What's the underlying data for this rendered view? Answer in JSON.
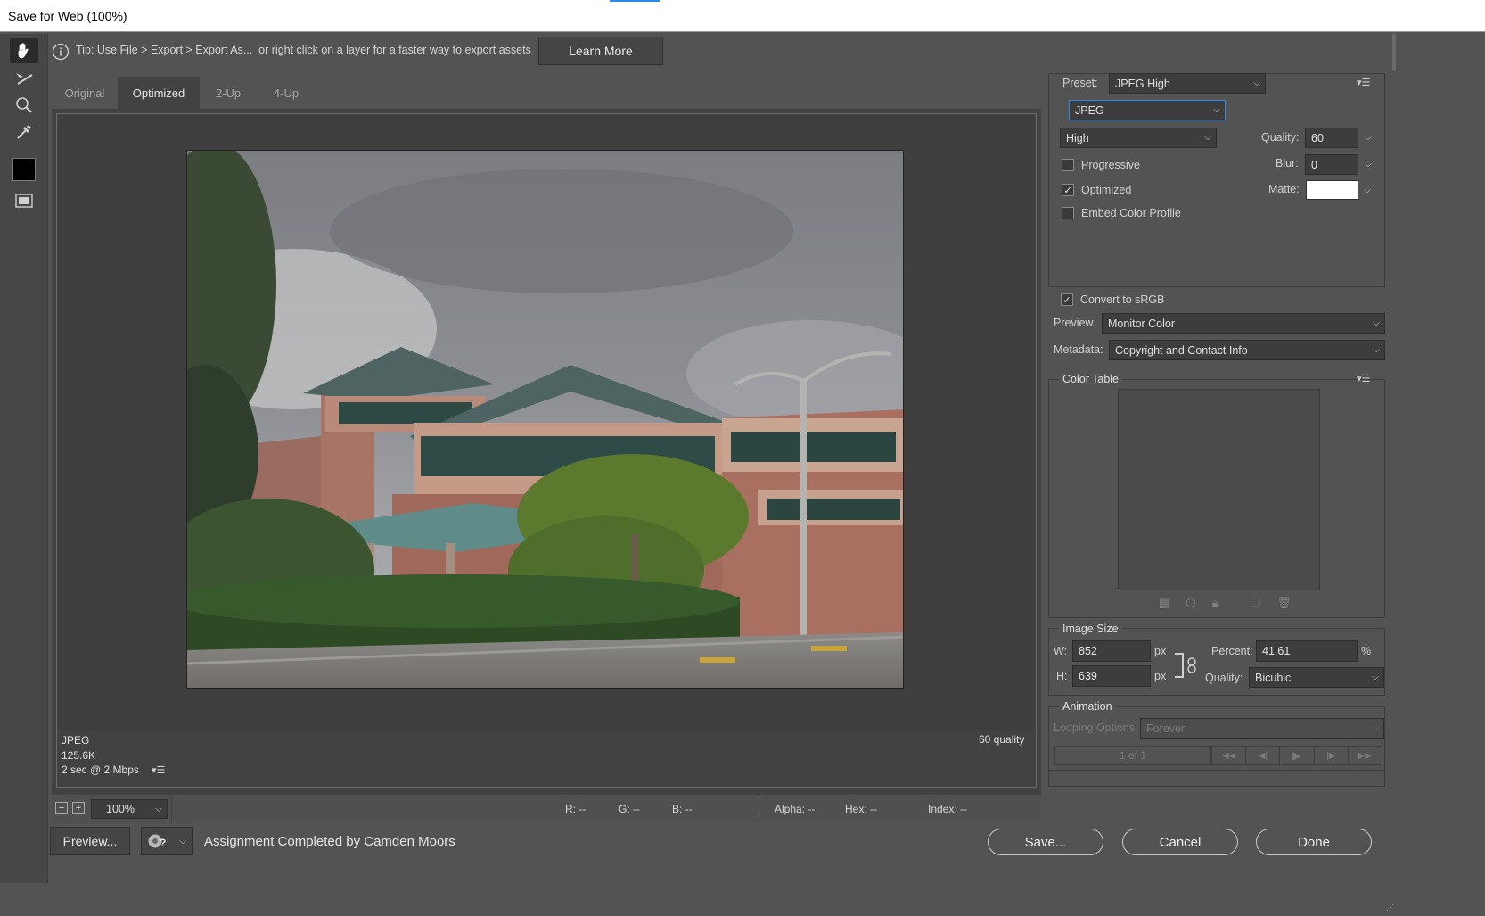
{
  "window": {
    "title": "Save for Web (100%)"
  },
  "tip": {
    "text": "Tip: Use File > Export > Export As...  or right click on a layer for a faster way to export assets",
    "learn_more": "Learn More"
  },
  "tabs": [
    {
      "label": "Original"
    },
    {
      "label": "Optimized"
    },
    {
      "label": "2-Up"
    },
    {
      "label": "4-Up"
    }
  ],
  "image_info": {
    "format": "JPEG",
    "size": "125.6K",
    "speed": "2 sec @ 2 Mbps",
    "quality": "60 quality"
  },
  "status": {
    "zoom": "100%",
    "r": "R: --",
    "g": "G: --",
    "b": "B: --",
    "alpha": "Alpha: --",
    "hex": "Hex: --",
    "index": "Index: --"
  },
  "bottom": {
    "preview_button": "Preview...",
    "status_text": "Assignment Completed by Camden Moors",
    "save": "Save...",
    "cancel": "Cancel",
    "done": "Done"
  },
  "settings": {
    "preset_label": "Preset:",
    "preset": "JPEG High",
    "format": "JPEG",
    "compression": "High",
    "quality_label": "Quality:",
    "quality": "60",
    "blur_label": "Blur:",
    "blur": "0",
    "matte_label": "Matte:",
    "progressive": "Progressive",
    "progressive_checked": false,
    "optimized": "Optimized",
    "optimized_checked": true,
    "embed_profile": "Embed Color Profile",
    "embed_checked": false,
    "convert_srgb": "Convert to sRGB",
    "convert_checked": true,
    "preview_label": "Preview:",
    "preview": "Monitor Color",
    "metadata_label": "Metadata:",
    "metadata": "Copyright and Contact Info"
  },
  "color_table": {
    "title": "Color Table"
  },
  "image_size": {
    "title": "Image Size",
    "w_label": "W:",
    "w": "852",
    "h_label": "H:",
    "h": "639",
    "unit": "px",
    "percent_label": "Percent:",
    "percent": "41.61",
    "percent_unit": "%",
    "quality_label": "Quality:",
    "quality": "Bicubic"
  },
  "animation": {
    "title": "Animation",
    "looping_label": "Looping Options:",
    "looping": "Forever",
    "frame": "1 of 1"
  },
  "colors": {
    "accent": "#2d8ceb",
    "panel": "#535353",
    "preview_bg": "#424242"
  }
}
